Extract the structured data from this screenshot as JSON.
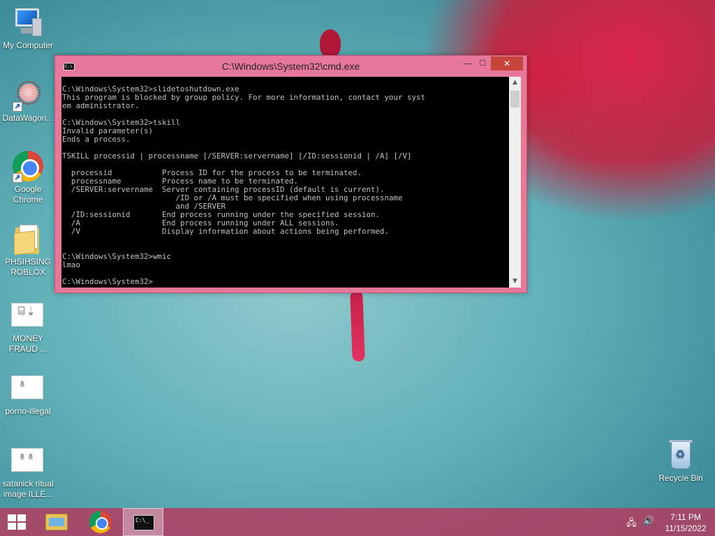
{
  "desktop": {
    "icons": [
      {
        "label": "My Computer"
      },
      {
        "label": "DataWagon..."
      },
      {
        "label": "Google Chrome"
      },
      {
        "label": "PHSIHSING ROBLOX"
      },
      {
        "label": "MONEY FRAUD ..."
      },
      {
        "label": "porno-illegal"
      },
      {
        "label": "satanick ritual image ILLE..."
      },
      {
        "label": "Recycle Bin"
      }
    ]
  },
  "cmd_window": {
    "title": "C:\\Windows\\System32\\cmd.exe",
    "icon_text": "C:\\",
    "controls": {
      "minimize": "—",
      "maximize": "☐",
      "close": "✕"
    },
    "console_lines": [
      "C:\\Windows\\System32>slidetoshutdown.exe",
      "This program is blocked by group policy. For more information, contact your syst",
      "em administrator.",
      "",
      "C:\\Windows\\System32>tskill",
      "Invalid parameter(s)",
      "Ends a process.",
      "",
      "TSKILL processid | processname [/SERVER:servername] [/ID:sessionid | /A] [/V]",
      "",
      "  processid           Process ID for the process to be terminated.",
      "  processname         Process name to be terminated.",
      "  /SERVER:servername  Server containing processID (default is current).",
      "                         /ID or /A must be specified when using processname",
      "                         and /SERVER",
      "  /ID:sessionid       End process running under the specified session.",
      "  /A                  End process running under ALL sessions.",
      "  /V                  Display information about actions being performed.",
      "",
      "",
      "C:\\Windows\\System32>wmic",
      "lmao",
      "",
      "C:\\Windows\\System32>"
    ]
  },
  "taskbar": {
    "cmd_icon_text": "C:\\_",
    "tray": {
      "network_icon": "network-icon",
      "volume_icon": "speaker-icon"
    },
    "clock": {
      "time": "7:11 PM",
      "date": "11/15/2022"
    }
  },
  "colors": {
    "window_frame": "#e8789a",
    "close_button": "#c7443a",
    "taskbar": "#b43c5f"
  }
}
